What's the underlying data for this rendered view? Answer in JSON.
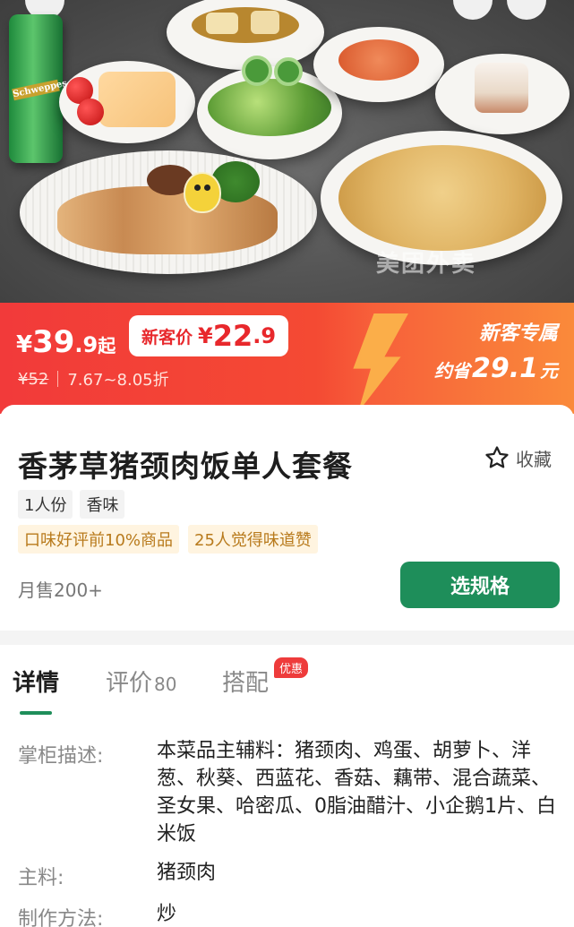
{
  "hero": {
    "can_brand": "Schweppes",
    "watermark_brand": "美团外卖"
  },
  "price": {
    "currency": "¥",
    "start_int": "39",
    "start_dec": ".9",
    "start_suffix": "起",
    "new_customer_label": "新客价",
    "new_customer_int": "22",
    "new_customer_dec": ".9",
    "original": "¥52",
    "discount_range": "7.67~8.05折"
  },
  "promo": {
    "title": "新客专属",
    "save_prefix": "约省",
    "save_amount": "29.1",
    "save_unit": "元"
  },
  "product": {
    "name": "香茅草猪颈肉饭单人套餐",
    "favorite_label": "收藏",
    "tags": [
      "1人份",
      "香味"
    ],
    "highlights": [
      "口味好评前10%商品",
      "25人觉得味道赞"
    ],
    "monthly_sales": "月售200+",
    "spec_button": "选规格"
  },
  "tabs": {
    "detail": "详情",
    "review": "评价",
    "review_count": "80",
    "combo": "搭配",
    "combo_badge": "优惠"
  },
  "details": {
    "desc_label": "掌柜描述:",
    "desc_value": "本菜品主辅料：猪颈肉、鸡蛋、胡萝卜、洋葱、秋葵、西蓝花、香菇、藕带、混合蔬菜、圣女果、哈密瓜、0脂油醋汁、小企鹅1片、白米饭",
    "main_label": "主料:",
    "main_value": "猪颈肉",
    "method_label": "制作方法:",
    "method_value": "炒"
  },
  "colors": {
    "banner_red": "#f23a3a",
    "banner_orange": "#fa8a3a",
    "accent_green": "#1e8e5a",
    "tag_gold": "#b87a1c"
  }
}
